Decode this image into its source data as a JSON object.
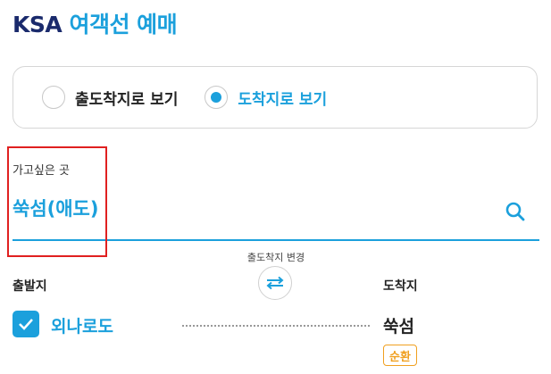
{
  "header": {
    "brand": "KSA",
    "title": "여객선 예매"
  },
  "mode": {
    "options": [
      {
        "label": "출도착지로 보기",
        "selected": false
      },
      {
        "label": "도착지로 보기",
        "selected": true
      }
    ]
  },
  "destination": {
    "label": "가고싶은 곳",
    "value": "쑥섬(애도)",
    "search_icon": "search-icon"
  },
  "route": {
    "swap_label": "출도착지 변경",
    "swap_icon": "swap-arrows-icon",
    "departure_label": "출발지",
    "arrival_label": "도착지",
    "departure_value": "외나로도",
    "arrival_value": "쑥섬",
    "trip_badge": "순환",
    "departure_checked": true
  },
  "colors": {
    "accent": "#1ba0dc",
    "brand": "#1a2a6c",
    "highlight_border": "#e02020",
    "badge": "#f0a020"
  }
}
